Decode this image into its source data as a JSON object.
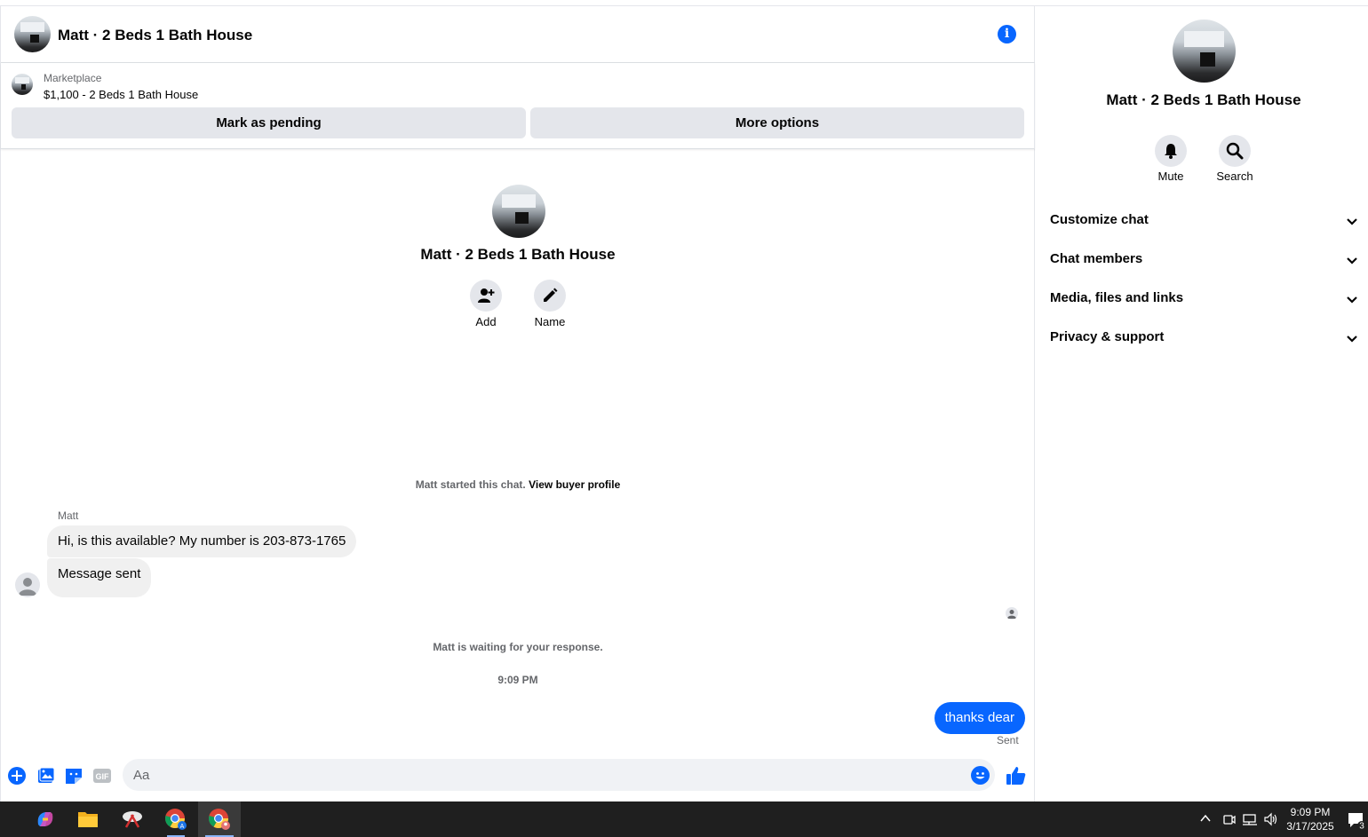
{
  "header": {
    "title": "Matt · 2 Beds 1 Bath House",
    "info_icon": "info-icon"
  },
  "marketplace": {
    "label": "Marketplace",
    "listing": "$1,100 - 2 Beds 1 Bath House",
    "mark_pending": "Mark as pending",
    "more_options": "More options"
  },
  "intro": {
    "title": "Matt · 2 Beds 1 Bath House",
    "add_label": "Add",
    "name_label": "Name"
  },
  "chat": {
    "started_text": "Matt started this chat.",
    "view_profile": "View buyer profile",
    "sender_name": "Matt",
    "messages_in": [
      "Hi, is this available? My number is 203-873-1765",
      "Message sent"
    ],
    "waiting_text": "Matt is waiting for your response.",
    "timestamp": "9:09 PM",
    "message_out": "thanks dear",
    "status": "Sent"
  },
  "composer": {
    "placeholder": "Aa",
    "icons": [
      "plus-icon",
      "photo-icon",
      "sticker-icon",
      "gif-icon",
      "emoji-icon",
      "like-icon"
    ],
    "gif_label": "GIF"
  },
  "sidebar": {
    "title": "Matt · 2 Beds 1 Bath House",
    "mute_label": "Mute",
    "search_label": "Search",
    "sections": [
      "Customize chat",
      "Chat members",
      "Media, files and links",
      "Privacy & support"
    ]
  },
  "taskbar": {
    "time": "9:09 PM",
    "date": "3/17/2025",
    "notification_count": "3"
  },
  "colors": {
    "accent": "#0866ff",
    "bubble_in": "#f0f0f0",
    "button_bg": "#e4e6eb",
    "taskbar": "#1f1f1f"
  }
}
